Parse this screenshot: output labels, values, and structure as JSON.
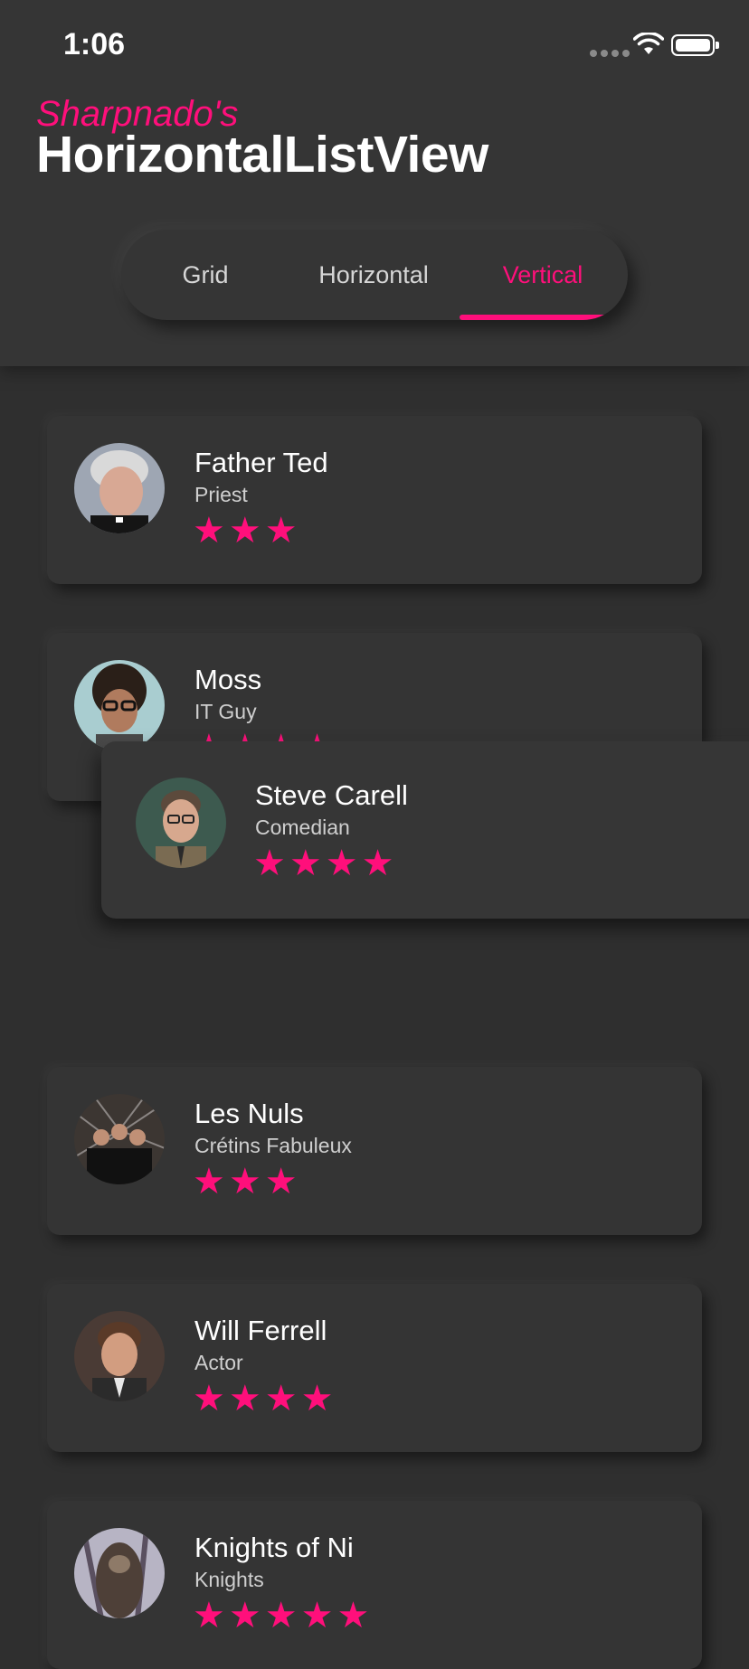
{
  "status_bar": {
    "time": "1:06"
  },
  "header": {
    "subtitle": "Sharpnado's",
    "title": "HorizontalListView"
  },
  "tabs": [
    {
      "label": "Grid",
      "selected": false
    },
    {
      "label": "Horizontal",
      "selected": false
    },
    {
      "label": "Vertical",
      "selected": true
    }
  ],
  "accent_color": "#ff0f7b",
  "list": [
    {
      "name": "Father Ted",
      "role": "Priest",
      "stars": "★★★",
      "rating": 3
    },
    {
      "name": "Moss",
      "role": "IT Guy",
      "stars": "★★★★",
      "rating": 4
    },
    {
      "name": "Les Nuls",
      "role": "Crétins Fabuleux",
      "stars": "★★★",
      "rating": 3
    },
    {
      "name": "Will Ferrell",
      "role": "Actor",
      "stars": "★★★★",
      "rating": 4
    },
    {
      "name": "Knights of Ni",
      "role": "Knights",
      "stars": "★★★★★",
      "rating": 5
    }
  ],
  "dragged_item": {
    "name": "Steve Carell",
    "role": "Comedian",
    "stars": "★★★★",
    "rating": 4
  }
}
